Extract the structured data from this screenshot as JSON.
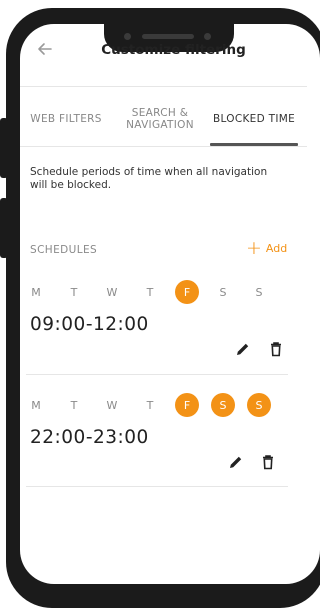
{
  "header": {
    "title": "Customize filtering",
    "back_icon": "arrow-left-icon"
  },
  "tabs": [
    {
      "label_line1": "WEB FILTERS",
      "label_line2": "",
      "active": false
    },
    {
      "label_line1": "SEARCH &",
      "label_line2": "NAVIGATION",
      "active": false
    },
    {
      "label_line1": "BLOCKED TIME",
      "label_line2": "",
      "active": true
    }
  ],
  "description": "Schedule periods of time when all navigation will be blocked.",
  "schedules_heading": "SCHEDULES",
  "add": {
    "icon": "+",
    "label": "Add"
  },
  "accent_color": "#f39216",
  "days": [
    "M",
    "T",
    "W",
    "T",
    "F",
    "S",
    "S"
  ],
  "schedules": [
    {
      "time": "09:00-12:00",
      "active_days": [
        false,
        false,
        false,
        false,
        true,
        false,
        false
      ]
    },
    {
      "time": "22:00-23:00",
      "active_days": [
        false,
        false,
        false,
        false,
        true,
        true,
        true
      ]
    }
  ],
  "actions": {
    "edit_icon": "pencil-icon",
    "delete_icon": "trash-icon"
  }
}
